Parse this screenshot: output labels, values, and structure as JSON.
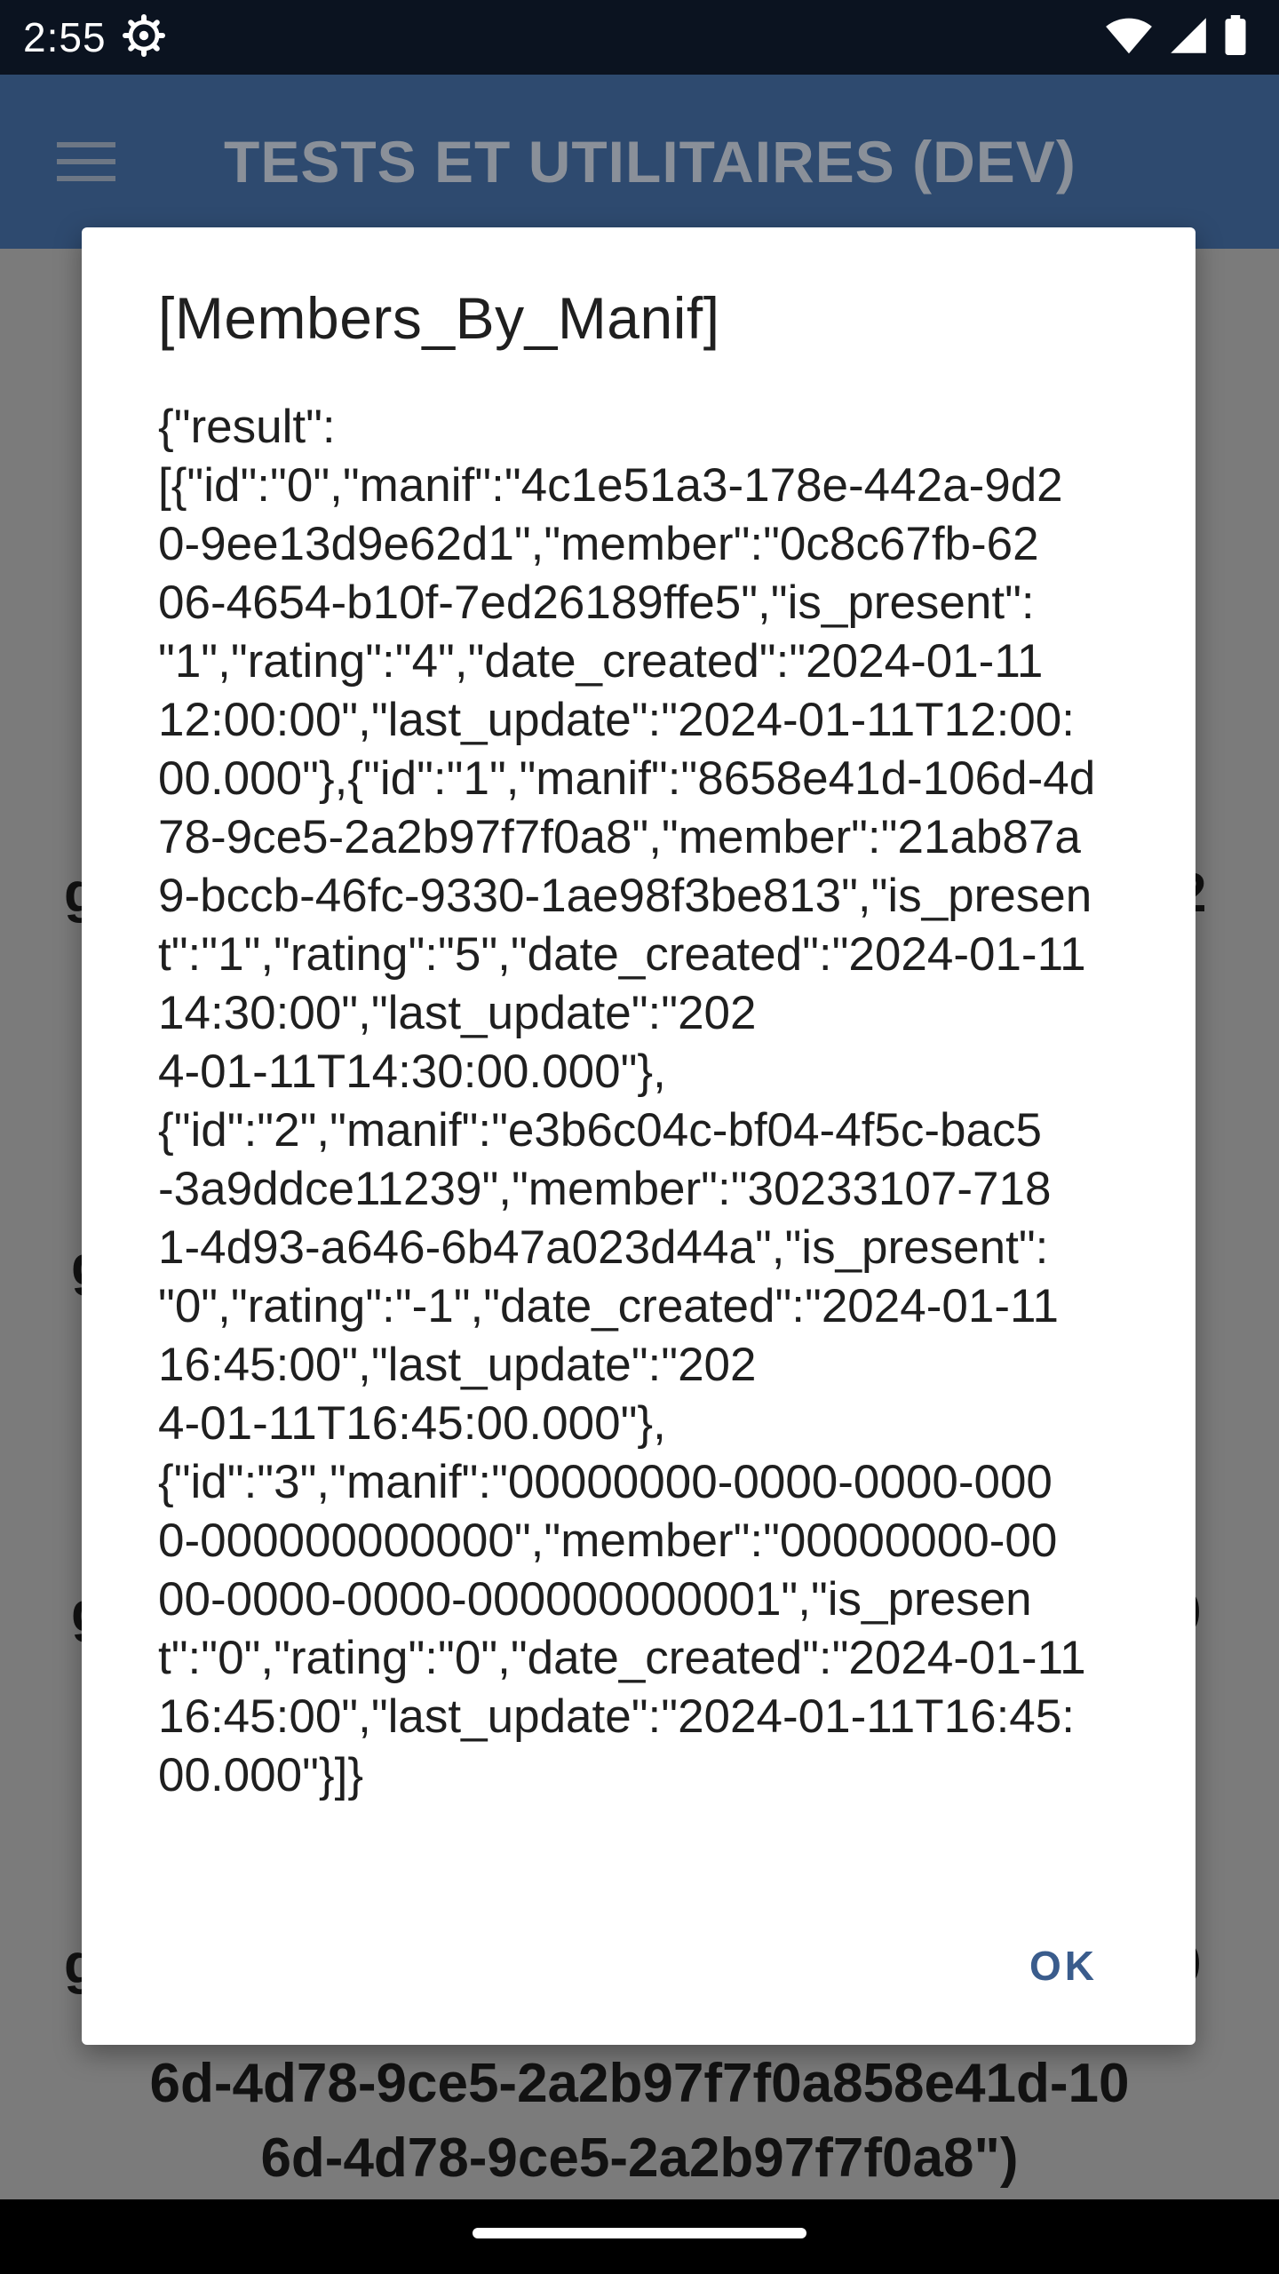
{
  "status_bar": {
    "time": "2:55",
    "icons": [
      "settings-icon",
      "wifi-icon",
      "cellular-signal-icon",
      "battery-icon"
    ]
  },
  "app_bar": {
    "title": "TESTS ET UTILITAIRES (DEV)",
    "menu_icon": "hamburger-menu-icon"
  },
  "background": {
    "fragments": [
      "g",
      "2",
      "g",
      "g",
      "0",
      "g",
      "0"
    ],
    "bottom_lines": [
      "6d-4d78-9ce5-2a2b97f7f0a858e41d-10",
      "6d-4d78-9ce5-2a2b97f7f0a8\")"
    ]
  },
  "dialog": {
    "title": "[Members_By_Manif]",
    "message": "{\"result\":\n[{\"id\":\"0\",\"manif\":\"4c1e51a3-178e-442a-9d2\n0-9ee13d9e62d1\",\"member\":\"0c8c67fb-62\n06-4654-b10f-7ed26189ffe5\",\"is_present\":\n\"1\",\"rating\":\"4\",\"date_created\":\"2024-01-11\n12:00:00\",\"last_update\":\"2024-01-11T12:00:\n00.000\"},{\"id\":\"1\",\"manif\":\"8658e41d-106d-4d\n78-9ce5-2a2b97f7f0a8\",\"member\":\"21ab87a\n9-bccb-46fc-9330-1ae98f3be813\",\"is_presen\nt\":\"1\",\"rating\":\"5\",\"date_created\":\"2024-01-11\n14:30:00\",\"last_update\":\"202\n4-01-11T14:30:00.000\"},\n{\"id\":\"2\",\"manif\":\"e3b6c04c-bf04-4f5c-bac5\n-3a9ddce11239\",\"member\":\"30233107-718\n1-4d93-a646-6b47a023d44a\",\"is_present\":\n\"0\",\"rating\":\"-1\",\"date_created\":\"2024-01-11\n16:45:00\",\"last_update\":\"202\n4-01-11T16:45:00.000\"},\n{\"id\":\"3\",\"manif\":\"00000000-0000-0000-000\n0-000000000000\",\"member\":\"00000000-00\n00-0000-0000-000000000001\",\"is_presen\nt\":\"0\",\"rating\":\"0\",\"date_created\":\"2024-01-11\n16:45:00\",\"last_update\":\"2024-01-11T16:45:\n00.000\"}]}",
    "ok_label": "OK"
  },
  "colors": {
    "status_bar": "#0b1320",
    "app_bar": "#2e4a6f",
    "scrim": "#7b7b7b",
    "dialog_bg": "#ffffff",
    "button_accent": "#3a5c8c"
  }
}
